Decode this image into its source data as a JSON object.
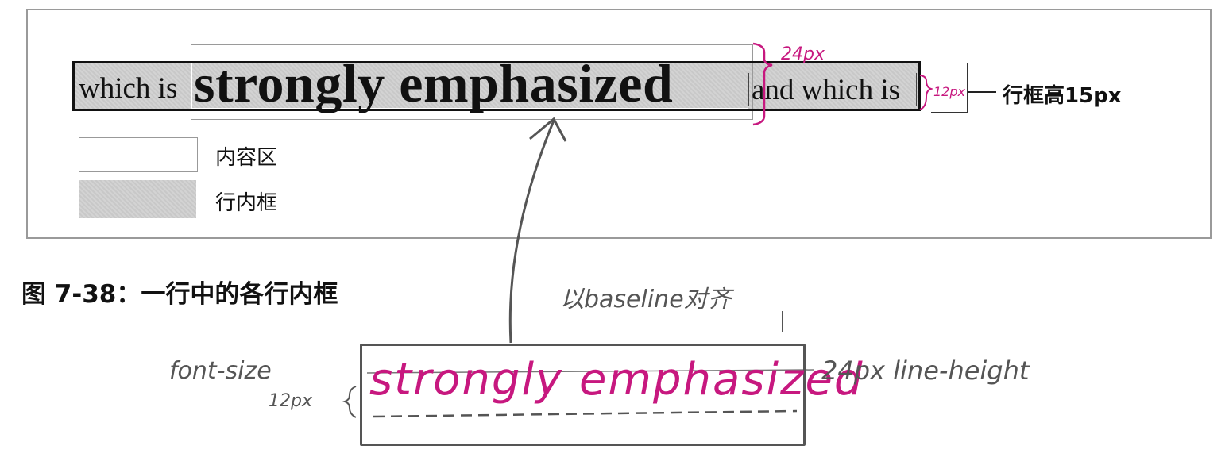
{
  "diagram": {
    "line_text": {
      "left": "which is",
      "strong": "strongly emphasized",
      "right": "and which is"
    },
    "line_box_label": "行框高15px",
    "legend": [
      {
        "label": "内容区"
      },
      {
        "label": "行内框"
      }
    ],
    "caption": "图 7-38：一行中的各行内框"
  },
  "annotations": {
    "top_bracket_label": "24px",
    "right_bracket_label": "12px",
    "baseline_note": "以baseline对齐",
    "font_size_label": "font-size",
    "font_size_value": "12px",
    "box_text": "strongly emphasized",
    "line_height_label": "24px line-height",
    "colors": {
      "magenta": "#c7187f",
      "pencil_gray": "#555555"
    }
  }
}
